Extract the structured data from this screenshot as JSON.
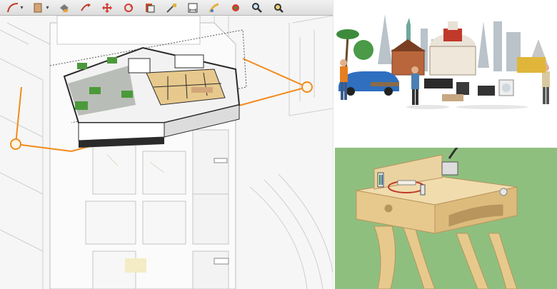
{
  "toolbar": {
    "tools": [
      {
        "name": "arc-tool",
        "icon": "arc-icon",
        "has_menu": true
      },
      {
        "name": "rectangle-tool",
        "icon": "rectangle-icon",
        "has_menu": true
      },
      {
        "name": "paint-bucket-tool",
        "icon": "paint-bucket-icon",
        "has_menu": false
      },
      {
        "name": "push-pull-tool",
        "icon": "push-pull-icon",
        "has_menu": false
      },
      {
        "name": "move-tool",
        "icon": "move-arrows-icon",
        "has_menu": false
      },
      {
        "name": "rotate-tool",
        "icon": "rotate-icon",
        "has_menu": false
      },
      {
        "name": "offset-tool",
        "icon": "offset-icon",
        "has_menu": false
      },
      {
        "name": "tape-measure-tool",
        "icon": "tape-measure-icon",
        "has_menu": false
      },
      {
        "name": "dimension-tool",
        "icon": "dimension-icon",
        "has_menu": false
      },
      {
        "name": "text-tool",
        "icon": "text-icon",
        "has_menu": false
      },
      {
        "name": "orbit-tool",
        "icon": "orbit-icon",
        "has_menu": false
      },
      {
        "name": "zoom-tool",
        "icon": "magnifier-icon",
        "has_menu": false
      },
      {
        "name": "zoom-extents-tool",
        "icon": "zoom-extents-icon",
        "has_menu": false
      }
    ]
  },
  "colors": {
    "guide_orange": "#f28a1a",
    "floor_green": "#4b9a3a",
    "wood": "#e7c98d",
    "panel_green": "#8fbf7f"
  }
}
